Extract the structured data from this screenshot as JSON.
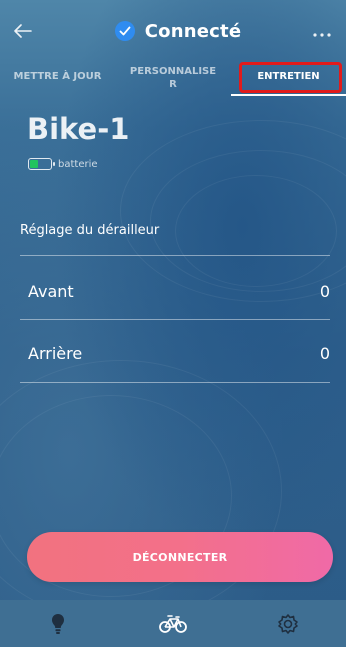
{
  "header": {
    "title": "Connecté",
    "back_icon": "back-arrow-icon",
    "status_icon": "check-circle-icon",
    "menu_icon": "more-horizontal-icon"
  },
  "tabs": [
    {
      "label": "METTRE À JOUR"
    },
    {
      "label_line1": "PERSONNALISE",
      "label_line2": "R"
    },
    {
      "label": "ENTRETIEN",
      "active": true
    }
  ],
  "bike": {
    "name": "Bike-1",
    "battery_label": "batterie",
    "battery_level_fraction": 0.35,
    "battery_color": "#22c35e"
  },
  "derailleur": {
    "section_title": "Réglage du dérailleur",
    "rows": [
      {
        "label": "Avant",
        "value": "0"
      },
      {
        "label": "Arrière",
        "value": "0"
      }
    ]
  },
  "actions": {
    "disconnect_label": "DÉCONNECTER"
  },
  "bottom_nav": [
    {
      "icon": "lightbulb-icon"
    },
    {
      "icon": "bicycle-icon"
    },
    {
      "icon": "gear-icon"
    }
  ],
  "colors": {
    "accent_blue": "#2f8cf0",
    "highlight_red": "#e11b1b",
    "disconnect_gradient_start": "#f2727f",
    "disconnect_gradient_end": "#f06aa7"
  }
}
